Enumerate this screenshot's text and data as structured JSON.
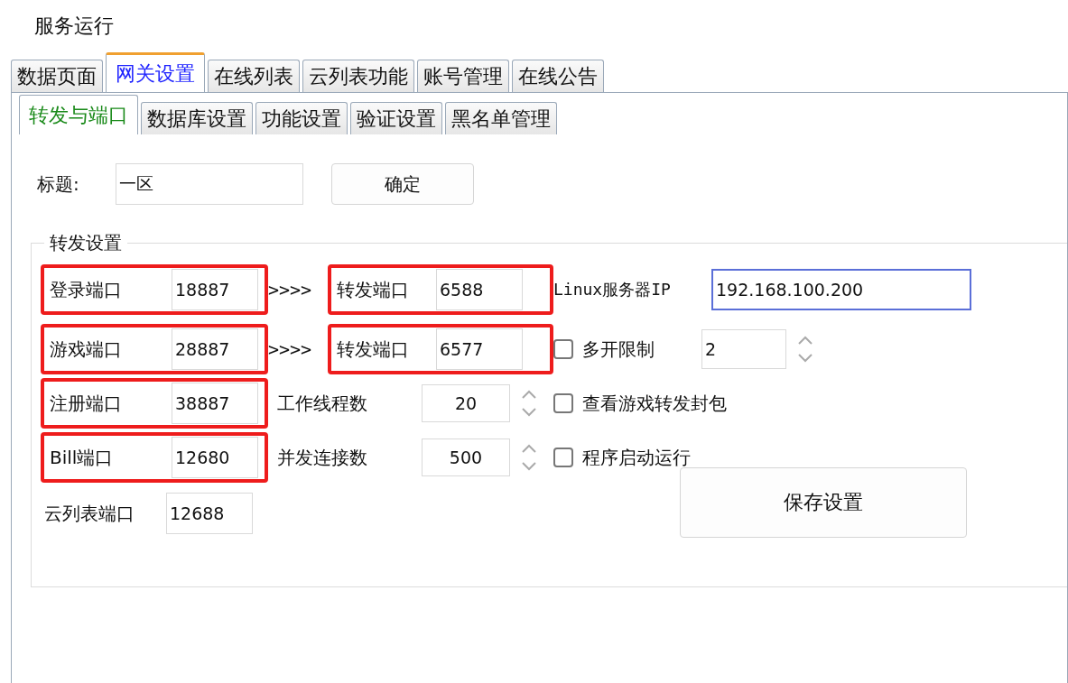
{
  "window": {
    "title": "服务运行"
  },
  "tabs": [
    {
      "label": "数据页面",
      "selected": false
    },
    {
      "label": "网关设置",
      "selected": true
    },
    {
      "label": "在线列表",
      "selected": false
    },
    {
      "label": "云列表功能",
      "selected": false
    },
    {
      "label": "账号管理",
      "selected": false
    },
    {
      "label": "在线公告",
      "selected": false
    }
  ],
  "subtabs": [
    {
      "label": "转发与端口",
      "selected": true
    },
    {
      "label": "数据库设置",
      "selected": false
    },
    {
      "label": "功能设置",
      "selected": false
    },
    {
      "label": "验证设置",
      "selected": false
    },
    {
      "label": "黑名单管理",
      "selected": false
    }
  ],
  "title_field": {
    "label": "标题:",
    "value": "一区"
  },
  "confirm_button": "确定",
  "group": {
    "title": "转发设置",
    "ports": [
      {
        "label": "登录端口",
        "value": "18887",
        "highlighted": true
      },
      {
        "label": "游戏端口",
        "value": "28887",
        "highlighted": true
      },
      {
        "label": "注册端口",
        "value": "38887",
        "highlighted": true
      },
      {
        "label": "Bill端口",
        "value": "12680",
        "highlighted": true
      },
      {
        "label": "云列表端口",
        "value": "12688",
        "highlighted": false
      }
    ],
    "forwards": [
      {
        "arrows": ">>>>",
        "label": "转发端口",
        "value": "6588",
        "highlighted": true
      },
      {
        "arrows": ">>>>",
        "label": "转发端口",
        "value": "6577",
        "highlighted": true
      }
    ],
    "spinners": [
      {
        "label": "工作线程数",
        "value": "20"
      },
      {
        "label": "并发连接数",
        "value": "500"
      }
    ],
    "server_ip": {
      "label": "Linux服务器IP",
      "value": "192.168.100.200"
    },
    "multi_open": {
      "label": "多开限制",
      "checked": false,
      "value": "2"
    },
    "checkboxes": [
      {
        "label": "查看游戏转发封包",
        "checked": false
      },
      {
        "label": "程序启动运行",
        "checked": false
      }
    ],
    "save_button": "保存设置"
  }
}
